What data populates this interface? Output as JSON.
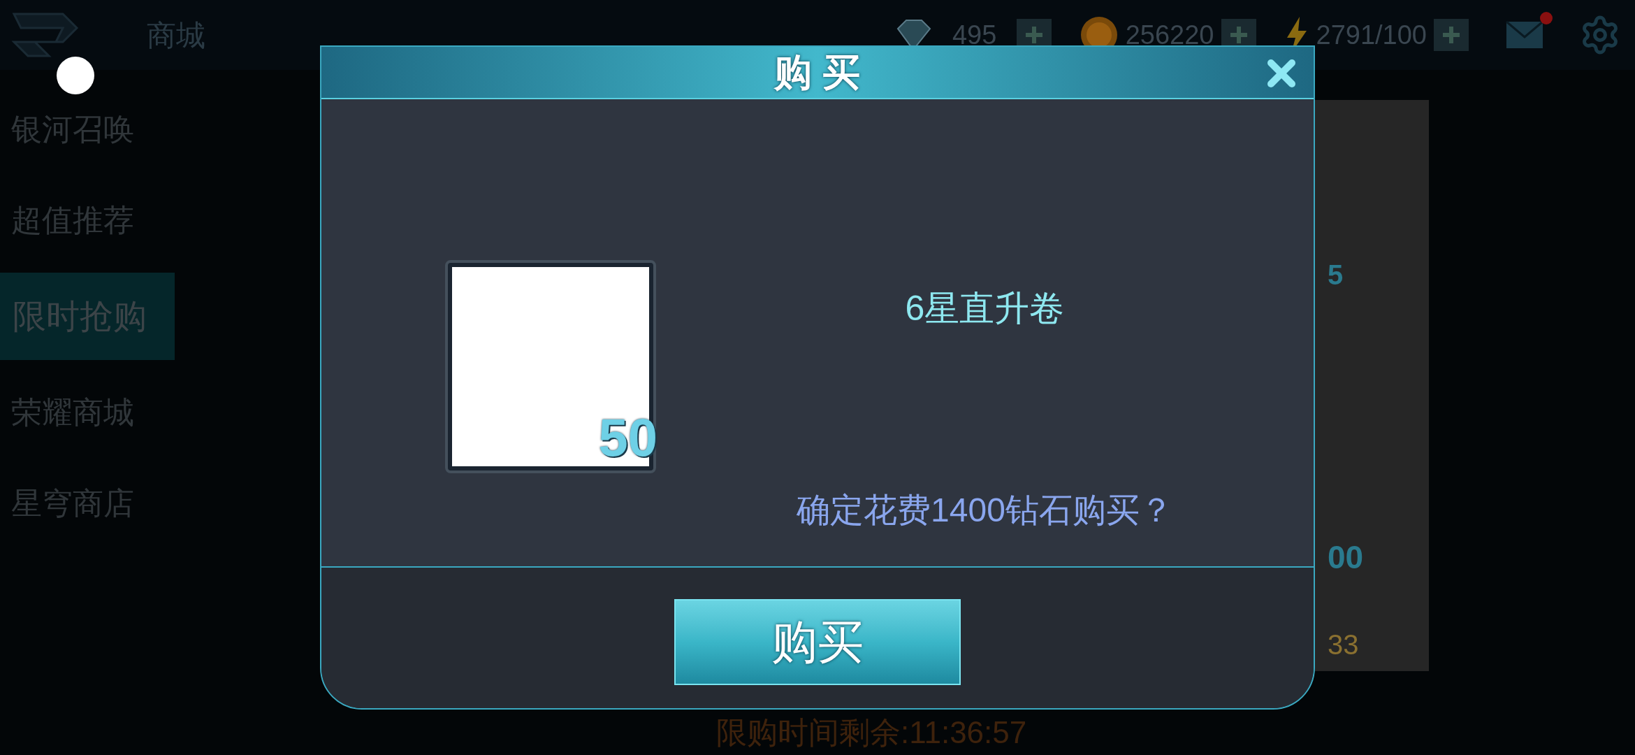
{
  "top_bar": {
    "title": "商城",
    "currencies": [
      {
        "kind": "diamond",
        "amount": "495"
      },
      {
        "kind": "coin",
        "amount": "256220"
      },
      {
        "kind": "energy",
        "amount": "2791/100"
      }
    ],
    "mail_unread": true
  },
  "sidebar": {
    "items": [
      {
        "label": "银河召唤",
        "selected": false
      },
      {
        "label": "超值推荐",
        "selected": false
      },
      {
        "label": "限时抢购",
        "selected": true
      },
      {
        "label": "荣耀商城",
        "selected": false
      },
      {
        "label": "星穹商店",
        "selected": false
      }
    ]
  },
  "shop_panel": {
    "fragment_1": "5",
    "fragment_2": "00",
    "fragment_3": "33"
  },
  "timer": "限购时间剩余:11:36:57",
  "dialog": {
    "title": "购 买",
    "item": {
      "name": "6星直升卷",
      "count": "50"
    },
    "question": "确定花费1400钻石购买？",
    "confirm_button": "购买"
  }
}
